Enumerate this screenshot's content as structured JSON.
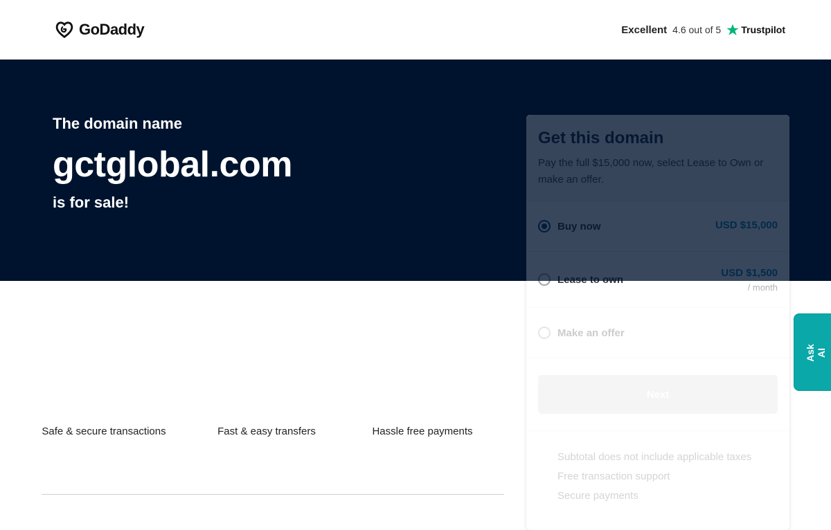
{
  "header": {
    "logo_text": "GoDaddy",
    "rating_label": "Excellent",
    "rating_score": "4.6 out of 5",
    "rating_brand": "Trustpilot"
  },
  "hero": {
    "pre_text": "The domain name",
    "domain": "gctglobal.com",
    "post_text": "is for sale!"
  },
  "card": {
    "title": "Get this domain",
    "description": "Pay the full $15,000 now, select Lease to Own or make an offer.",
    "options": [
      {
        "label": "Buy now",
        "price": "USD $15,000",
        "selected": true
      },
      {
        "label": "Lease to own",
        "price": "USD $1,500",
        "price_sub": "/ month",
        "selected": false
      },
      {
        "label": "Make an offer",
        "selected": false
      }
    ],
    "next_label": "Next",
    "bullets": [
      "Subtotal does not include applicable taxes",
      "Free transaction support",
      "Secure payments"
    ]
  },
  "features": [
    {
      "label": "Safe & secure transactions"
    },
    {
      "label": "Fast & easy transfers"
    },
    {
      "label": "Hassle free payments"
    }
  ],
  "ask_ai": {
    "label": "Ask AI"
  },
  "colors": {
    "hero_bg": "#00132e",
    "trustpilot_star": "#00b67a",
    "price": "#0b7ea8",
    "ask_ai_bg": "#0aa8a8"
  }
}
